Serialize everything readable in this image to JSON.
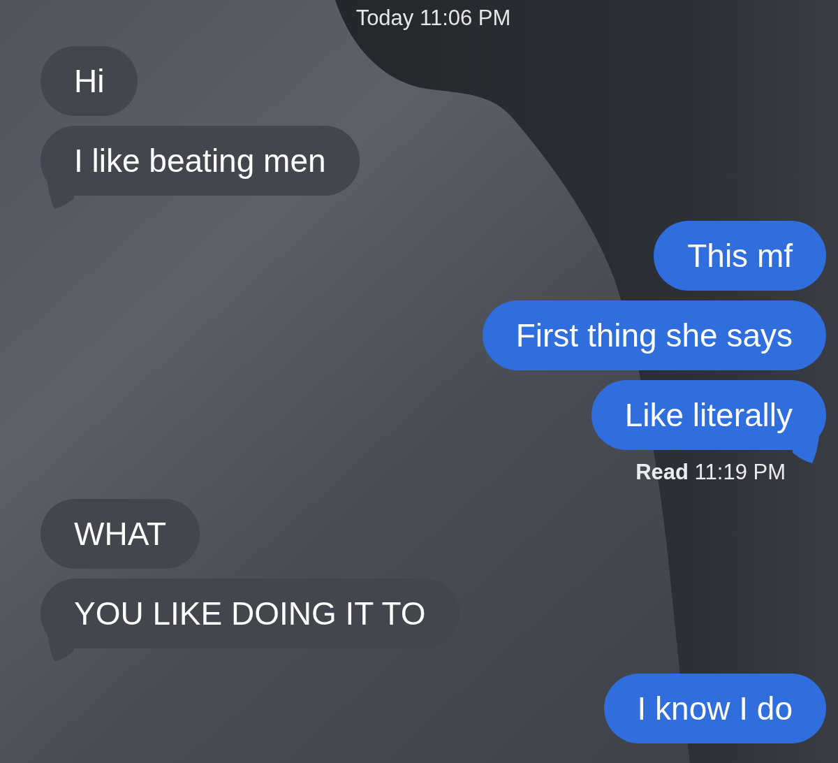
{
  "thread": [
    {
      "kind": "timestamp",
      "text": "Today 11:06 PM"
    },
    {
      "kind": "received",
      "text": "Hi",
      "tail": false
    },
    {
      "kind": "received",
      "text": "I like beating men",
      "tail": true
    },
    {
      "kind": "sent",
      "text": "This mf",
      "tail": false
    },
    {
      "kind": "sent",
      "text": "First thing she says",
      "tail": false
    },
    {
      "kind": "sent",
      "text": "Like literally",
      "tail": true
    },
    {
      "kind": "receipt",
      "text": "**Read** 11:19 PM"
    },
    {
      "kind": "received",
      "text": "WHAT",
      "tail": false
    },
    {
      "kind": "received",
      "text": "YOU LIKE DOING IT TO",
      "tail": true
    },
    {
      "kind": "sent",
      "text": "I know I do",
      "tail": false
    }
  ]
}
